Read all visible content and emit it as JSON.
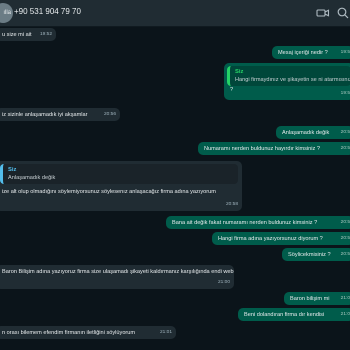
{
  "header": {
    "avatar_text": "ılla",
    "phone": "+90 531 904 79 70"
  },
  "messages": [
    {
      "dir": "in",
      "text": "u size mi ait",
      "time": "19:52"
    },
    {
      "dir": "out",
      "text": "Mesaj içeriği nedir ?",
      "time": "19:5"
    },
    {
      "dir": "out",
      "quote_author": "Siz",
      "quote_text": "Hangi firmaydınız ve şikayetin se ni atarmısınız",
      "text": "?",
      "time": "19:5"
    },
    {
      "dir": "in",
      "text": "iz sizinle anlaşamadık iyi akşamlar",
      "time": "20:56"
    },
    {
      "dir": "out",
      "text": "Anlaşamadık değik",
      "time": "20:5"
    },
    {
      "dir": "out",
      "text": "Numaramı nerden buldunuz hayırdır kimsiniz ?",
      "time": "20:5"
    },
    {
      "dir": "in",
      "quote_author": "Siz",
      "quote_text": "Anlaşamadık değik",
      "text": "ize alt olup olmadığını söylemiyorsunuz söylesenız anlaşacağız firma adına yazıyorum",
      "time": "20:58"
    },
    {
      "dir": "out",
      "text": "Bana ait değik fakat numaramı nerden buldunuz kimsiniz ?",
      "time": "20:5"
    },
    {
      "dir": "out",
      "text": "Hangi firma adına yazıyorsunuz diyorum ?",
      "time": "20:5"
    },
    {
      "dir": "out",
      "text": "Söylicekmisiniz ?",
      "time": "20:5"
    },
    {
      "dir": "in",
      "text": "Baron Bilişim adına yazıyoruz firma size ulaşamadı şikayeti kaldırmanız karşılığında",
      "text2": "endi web sitesinden her hangi bir ürünü hediye edecekleriniz bildirdiler.",
      "time": "21:00"
    },
    {
      "dir": "out",
      "text": "Baron bilişim mi",
      "time": "21:0"
    },
    {
      "dir": "out",
      "text": "Beni dolandıran firma dır kendisi",
      "time": "21:0"
    },
    {
      "dir": "in",
      "text": "n orası bilemem efendim firmanın iletliğini söylüyorum",
      "time": "21:01"
    }
  ]
}
